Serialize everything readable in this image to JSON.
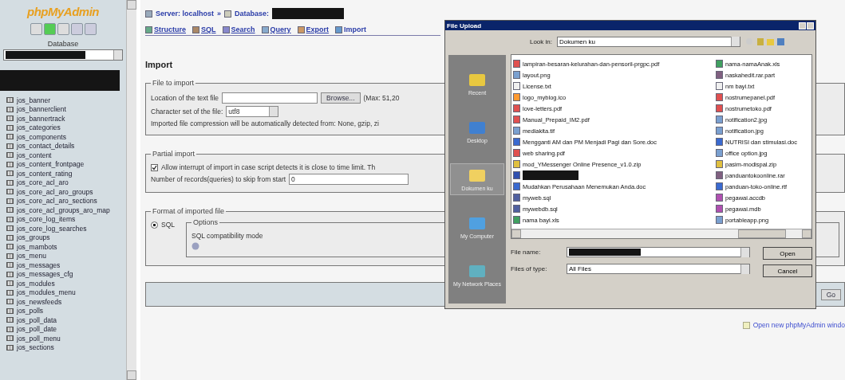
{
  "sidebar": {
    "logo": "phpMyAdmin",
    "database_label": "Database",
    "tables": [
      "jos_banner",
      "jos_bannerclient",
      "jos_bannertrack",
      "jos_categories",
      "jos_components",
      "jos_contact_details",
      "jos_content",
      "jos_content_frontpage",
      "jos_content_rating",
      "jos_core_acl_aro",
      "jos_core_acl_aro_groups",
      "jos_core_acl_aro_sections",
      "jos_core_acl_groups_aro_map",
      "jos_core_log_items",
      "jos_core_log_searches",
      "jos_groups",
      "jos_mambots",
      "jos_menu",
      "jos_messages",
      "jos_messages_cfg",
      "jos_modules",
      "jos_modules_menu",
      "jos_newsfeeds",
      "jos_polls",
      "jos_poll_data",
      "jos_poll_date",
      "jos_poll_menu",
      "jos_sections"
    ]
  },
  "breadcrumb": {
    "server": "Server: localhost",
    "separator": "»",
    "database": "Database:"
  },
  "tabs": [
    {
      "label": "Structure",
      "selected": false
    },
    {
      "label": "SQL",
      "selected": false
    },
    {
      "label": "Search",
      "selected": false
    },
    {
      "label": "Query",
      "selected": false
    },
    {
      "label": "Export",
      "selected": false
    },
    {
      "label": "Import",
      "selected": true
    }
  ],
  "heading": "Import",
  "file_to_import": {
    "legend": "File to import",
    "location_label": "Location of the text file",
    "browse_button": "Browse...",
    "max_note": "(Max: 51,20",
    "charset_label": "Character set of the file:",
    "charset_value": "utf8",
    "compression_note": "Imported file compression will be automatically detected from: None, gzip, zi"
  },
  "partial_import": {
    "legend": "Partial import",
    "allow_interrupt": {
      "label": "Allow interrupt of import in case script detects it is close to time limit. Th",
      "checked": true
    },
    "skip_label": "Number of records(queries) to skip from start",
    "skip_value": "0"
  },
  "format": {
    "legend": "Format of imported file",
    "options": [
      {
        "label": "SQL",
        "selected": true
      }
    ],
    "options_legend": "Options",
    "compat_label": "SQL compatibility mode"
  },
  "go_button": "Go",
  "new_window_link": "Open new phpMyAdmin windo",
  "dialog": {
    "title": "File Upload",
    "look_in_label": "Look in:",
    "look_in_value": "Dokumen ku",
    "places": [
      {
        "label": "Recent",
        "selected": false
      },
      {
        "label": "Desktop",
        "selected": false
      },
      {
        "label": "Dokumen ku",
        "selected": true
      },
      {
        "label": "My Computer",
        "selected": false
      },
      {
        "label": "My Network Places",
        "selected": false
      }
    ],
    "files": [
      {
        "kind": "pdf",
        "name": "lampiran-besaran-kelurahan-dan-pensoril-prgpc.pdf"
      },
      {
        "kind": "image",
        "name": "layout.png"
      },
      {
        "kind": "text",
        "name": "License.txt"
      },
      {
        "kind": "ico",
        "name": "logo_myblog.ico"
      },
      {
        "kind": "pdf",
        "name": "love-letters.pdf"
      },
      {
        "kind": "pdf",
        "name": "Manual_Prepaid_IM2.pdf"
      },
      {
        "kind": "image",
        "name": "mediakita.tif"
      },
      {
        "kind": "doc",
        "name": "Mengganti AM dan PM Menjadi Pagi dan Sore.doc"
      },
      {
        "kind": "pdf",
        "name": "web sharing.pdf"
      },
      {
        "kind": "zip",
        "name": "mod_YMessenger Online Presence_v1.0.zip"
      },
      {
        "kind": "redacted"
      },
      {
        "kind": "doc",
        "name": "Mudahkan Perusahaan Menemukan Anda.doc"
      },
      {
        "kind": "sql",
        "name": "myweb.sql"
      },
      {
        "kind": "sql",
        "name": "mywebdb.sql"
      },
      {
        "kind": "xls",
        "name": "nama bayi.xls"
      },
      {
        "kind": "xls",
        "name": "nama-namaAnak.xls"
      },
      {
        "kind": "rar",
        "name": "naskahedit.rar.part"
      },
      {
        "kind": "text",
        "name": "nm bayi.txt"
      },
      {
        "kind": "pdf",
        "name": "nostrumepanel.pdf"
      },
      {
        "kind": "pdf",
        "name": "nostrumetoko.pdf"
      },
      {
        "kind": "image",
        "name": "notification2.jpg"
      },
      {
        "kind": "image",
        "name": "notification.jpg"
      },
      {
        "kind": "doc",
        "name": "NUTRISI dan stimulasi.doc"
      },
      {
        "kind": "image",
        "name": "office option.jpg"
      },
      {
        "kind": "zip",
        "name": "pasim-modispal.zip"
      },
      {
        "kind": "rar",
        "name": "panduantokoonline.rar"
      },
      {
        "kind": "doc",
        "name": "panduan-toko-online.rtf"
      },
      {
        "kind": "db",
        "name": "pegawai.accdb"
      },
      {
        "kind": "db",
        "name": "pegawai.mdb"
      },
      {
        "kind": "image",
        "name": "portableapp.png"
      }
    ],
    "file_name_label": "File name:",
    "files_of_type_label": "Files of type:",
    "files_of_type_value": "All Files",
    "buttons": [
      "Open",
      "Cancel"
    ]
  }
}
